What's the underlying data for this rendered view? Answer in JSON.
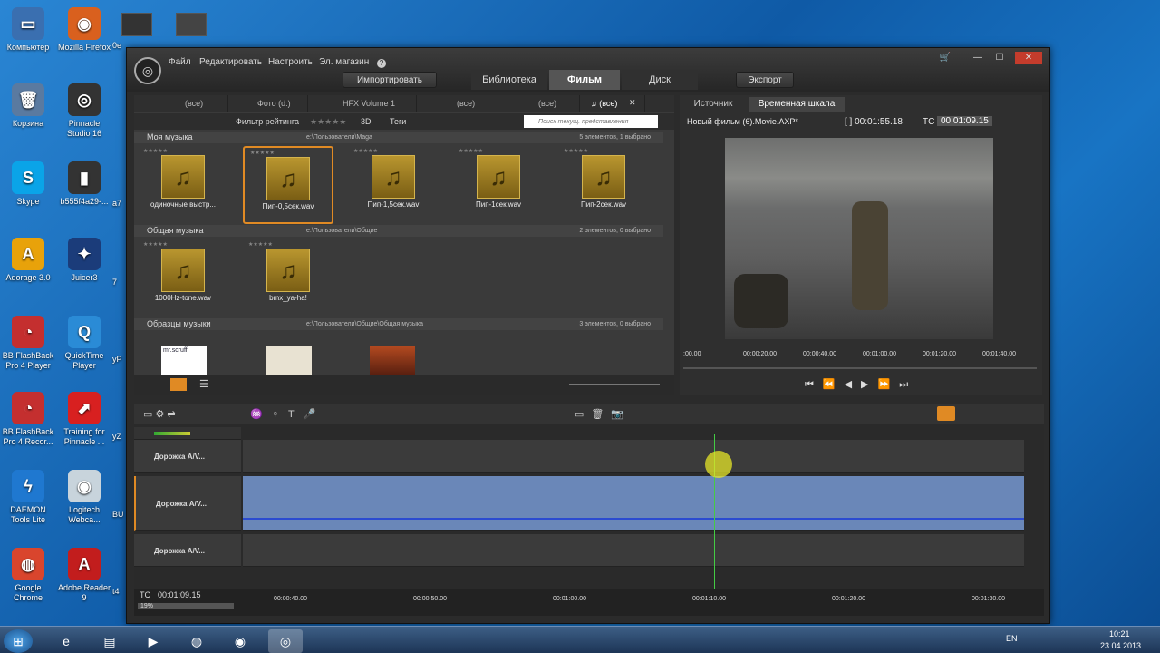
{
  "desktop": {
    "icons": [
      {
        "label": "Компьютер",
        "glyph": "▭",
        "color": "#3a6fb0"
      },
      {
        "label": "Mozilla Firefox",
        "glyph": "◉",
        "color": "#d9601e"
      },
      {
        "label": "Корзина",
        "glyph": "🗑",
        "color": "#5a7aa0"
      },
      {
        "label": "Pinnacle Studio 16",
        "glyph": "◎",
        "color": "#333"
      },
      {
        "label": "Skype",
        "glyph": "S",
        "color": "#0aa4e8"
      },
      {
        "label": "b555f4a29-...",
        "glyph": "▮",
        "color": "#333"
      },
      {
        "label": "Adorage 3.0",
        "glyph": "A",
        "color": "#e8a20a"
      },
      {
        "label": "Juicer3",
        "glyph": "✦",
        "color": "#1b3c7a"
      },
      {
        "label": "BB FlashBack Pro 4 Player",
        "glyph": "◔",
        "color": "#c42f2f"
      },
      {
        "label": "QuickTime Player",
        "glyph": "Q",
        "color": "#2a8bd6"
      },
      {
        "label": "BB FlashBack Pro 4 Recor...",
        "glyph": "◔",
        "color": "#c42f2f"
      },
      {
        "label": "Training for Pinnacle ...",
        "glyph": "⬈",
        "color": "#d82020"
      },
      {
        "label": "DAEMON Tools Lite",
        "glyph": "ϟ",
        "color": "#1f78d0"
      },
      {
        "label": "Logitech Webca...",
        "glyph": "◉",
        "color": "#c8d4dc"
      },
      {
        "label": "Google Chrome",
        "glyph": "◍",
        "color": "#d9452d"
      },
      {
        "label": "Adobe Reader 9",
        "glyph": "A",
        "color": "#c21d1d"
      }
    ],
    "strip_labels": [
      "0e",
      "a7",
      "7",
      "yP",
      "yZ",
      "BU",
      "t4"
    ]
  },
  "window": {
    "menu": [
      "Файл",
      "Редактировать",
      "Настроить",
      "Эл. магазин"
    ],
    "help_icon": "?",
    "import_button": "Импортировать",
    "tabs": [
      "Библиотека",
      "Фильм",
      "Диск"
    ],
    "active_tab": "Фильм",
    "export_button": "Экспорт",
    "controls": [
      "🛒",
      "—",
      "☐",
      "✕"
    ]
  },
  "library": {
    "tabs": [
      {
        "label": "(все)",
        "active": false
      },
      {
        "label": "Фото (d:)",
        "active": false
      },
      {
        "label": "HFX Volume 1",
        "active": false
      },
      {
        "label": "(все)",
        "active": false
      },
      {
        "label": "(все)",
        "active": false
      },
      {
        "label": "♫ (все)",
        "active": true
      }
    ],
    "filter_label": "Фильтр рейтинга",
    "stars": "★★★★★",
    "btn_3d": "3D",
    "btn_tags": "Теги",
    "search_placeholder": "Поиск текущ. представления",
    "groups": [
      {
        "title": "Моя музыка",
        "path": "e:\\Пользователи\\Maga",
        "count": "5 элементов, 1 выбрано"
      },
      {
        "title": "Общая музыка",
        "path": "e:\\Пользователи\\Общие",
        "count": "2 элементов, 0 выбрано"
      },
      {
        "title": "Образцы музыки",
        "path": "e:\\Пользователи\\Общие\\Общая музыка",
        "count": "3 элементов, 0 выбрано"
      }
    ],
    "group1_items": [
      "одиночные выстр...",
      "Пип-0,5сек.wav",
      "Пип-1,5сек.wav",
      "Пип-1сек.wav",
      "Пип-2сек.wav"
    ],
    "group2_items": [
      "1000Hz-tone.wav",
      "bmx_ya-ha!"
    ],
    "selected_item": "Пип-0,5сек.wav",
    "thumb_text": "mr.scruff"
  },
  "player": {
    "tabs": [
      "Источник",
      "Временная шкала"
    ],
    "active_tab": "Временная шкала",
    "movie_title": "Новый фильм (6).Movie.AXP*",
    "duration": "[ ] 00:01:55.18",
    "tc_label": "TC",
    "tc_value": "00:01:09.15",
    "ruler": [
      ":00.00",
      "00:00:20.00",
      "00:00:40.00",
      "00:01:00.00",
      "00:01:20.00",
      "00:01:40.00"
    ]
  },
  "timeline": {
    "tracks": [
      "Дорожка A/V...",
      "Дорожка A/V...",
      "Дорожка A/V..."
    ],
    "tc_label": "TC",
    "tc_value": "00:01:09.15",
    "zoom": "19%",
    "ruler": [
      "00:00:40.00",
      "00:00:50.00",
      "00:01:00.00",
      "00:01:10.00",
      "00:01:20.00",
      "00:01:30.00"
    ]
  },
  "taskbar": {
    "lang": "EN",
    "time": "10:21",
    "date": "23.04.2013"
  }
}
